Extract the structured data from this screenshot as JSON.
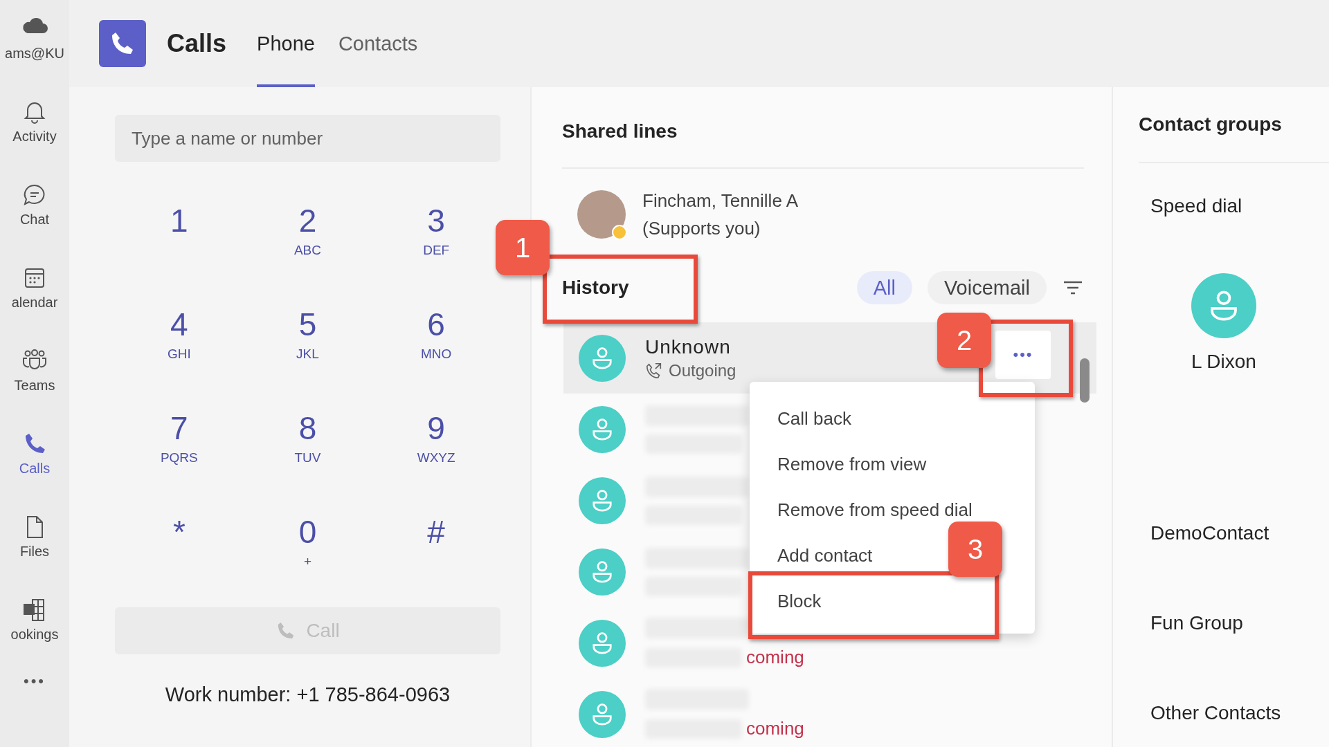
{
  "rail": {
    "items": [
      {
        "label": "ams@KU",
        "selected": false
      },
      {
        "label": "Activity",
        "selected": false
      },
      {
        "label": "Chat",
        "selected": false
      },
      {
        "label": "alendar",
        "selected": false
      },
      {
        "label": "Teams",
        "selected": false
      },
      {
        "label": "Calls",
        "selected": true
      },
      {
        "label": "Files",
        "selected": false
      },
      {
        "label": "ookings",
        "selected": false
      }
    ],
    "more": "•••"
  },
  "header": {
    "title": "Calls",
    "tabs": [
      {
        "label": "Phone",
        "selected": true
      },
      {
        "label": "Contacts",
        "selected": false
      }
    ]
  },
  "dialer": {
    "search": {
      "placeholder": "Type a name or number"
    },
    "keys": [
      {
        "digit": "1"
      },
      {
        "digit": "2",
        "letters": "ABC"
      },
      {
        "digit": "3",
        "letters": "DEF"
      },
      {
        "digit": "4",
        "letters": "GHI"
      },
      {
        "digit": "5",
        "letters": "JKL"
      },
      {
        "digit": "6",
        "letters": "MNO"
      },
      {
        "digit": "7",
        "letters": "PQRS"
      },
      {
        "digit": "8",
        "letters": "TUV"
      },
      {
        "digit": "9",
        "letters": "WXYZ"
      },
      {
        "digit": "*"
      },
      {
        "digit": "0",
        "letters": "+"
      },
      {
        "digit": "#"
      }
    ],
    "call_button": {
      "label": "Call",
      "disabled": true
    },
    "work_number": "Work number: +1 785-864-0963"
  },
  "shared_lines": {
    "title": "Shared lines",
    "line": {
      "name": "Fincham, Tennille A",
      "note": "(Supports you)"
    }
  },
  "history": {
    "title": "History",
    "filters": [
      {
        "label": "All",
        "selected": true
      },
      {
        "label": "Voicemail",
        "selected": false
      }
    ],
    "rows": [
      {
        "kind": "visible",
        "name": "Unknown",
        "direction": "Outgoing",
        "selected": true
      },
      {
        "kind": "redacted",
        "selected": false
      },
      {
        "kind": "redacted",
        "selected": false
      },
      {
        "kind": "redacted",
        "selected": false
      },
      {
        "kind": "redacted",
        "status_fragment": "coming",
        "selected": false
      },
      {
        "kind": "redacted",
        "status_fragment": "coming",
        "selected": false
      }
    ],
    "more_button": "•••",
    "menu": [
      "Call back",
      "Remove from view",
      "Remove from speed dial",
      "Add contact",
      "Block"
    ]
  },
  "contact_groups": {
    "title": "Contact groups",
    "groups": [
      {
        "name": "Speed dial",
        "contacts": [
          "L Dixon"
        ]
      },
      {
        "name": "DemoContact"
      },
      {
        "name": "Fun Group"
      },
      {
        "name": "Other Contacts"
      }
    ]
  },
  "annotations": [
    {
      "label": "1"
    },
    {
      "label": "2"
    },
    {
      "label": "3"
    }
  ]
}
